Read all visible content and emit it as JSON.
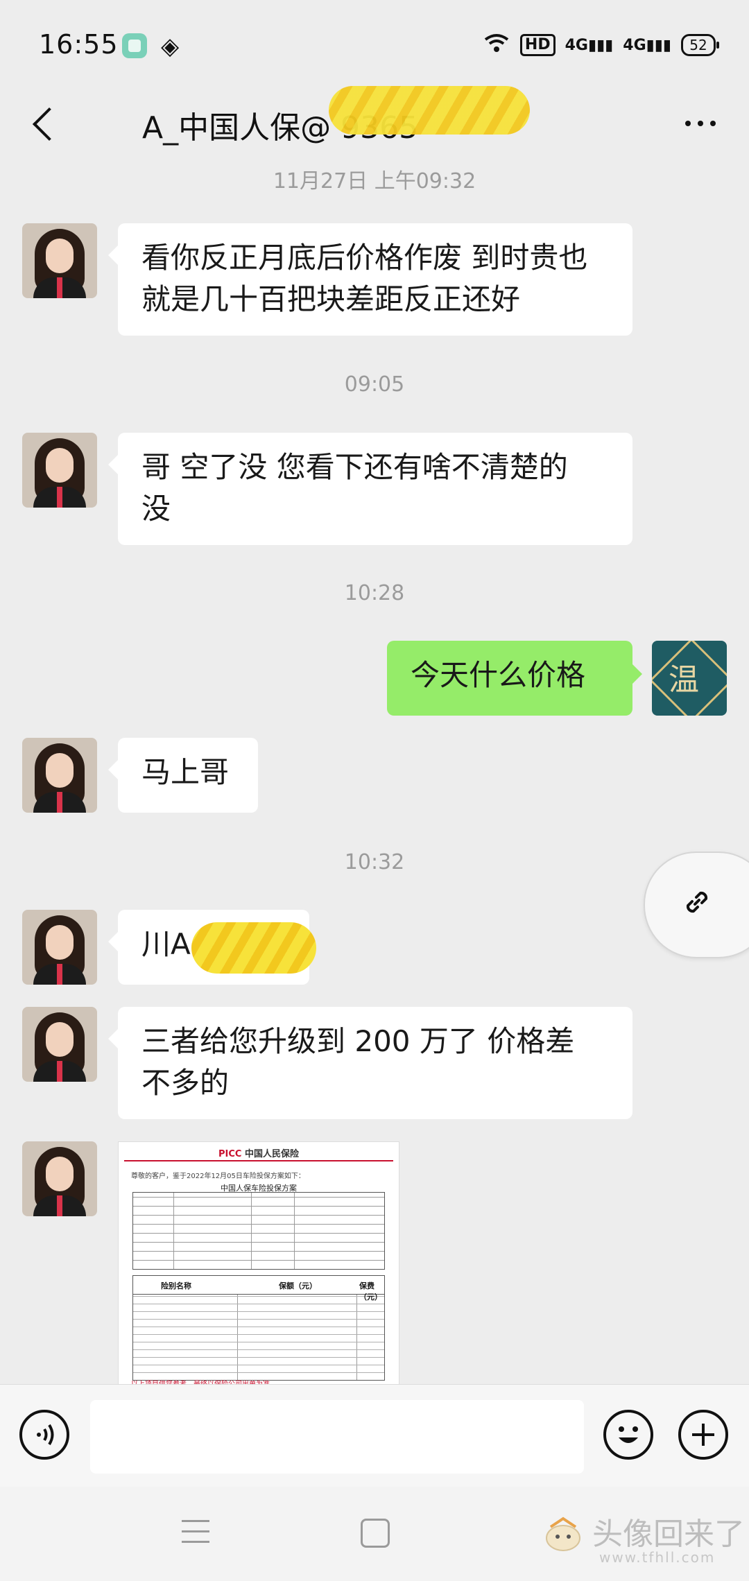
{
  "status_bar": {
    "time": "16:55",
    "network": "4G",
    "network2": "4G",
    "hd": "HD",
    "battery": "52"
  },
  "header": {
    "back_icon": "chevron-left-icon",
    "title": "A_中国人保@ 9365",
    "more_icon": "more-dots-icon"
  },
  "messages": [
    {
      "type": "time",
      "text": "11月27日 上午09:32"
    },
    {
      "type": "text",
      "side": "left",
      "lines": [
        "看你反正月底后价格作废 到时贵也",
        "就是几十百把块差距反正还好"
      ]
    },
    {
      "type": "time",
      "text": "09:05"
    },
    {
      "type": "text",
      "side": "left",
      "lines": [
        "哥  空了没  您看下还有啥不清楚的",
        "没"
      ]
    },
    {
      "type": "time",
      "text": "10:28"
    },
    {
      "type": "text",
      "side": "right",
      "lines": [
        "今天什么价格"
      ]
    },
    {
      "type": "text",
      "side": "left",
      "lines": [
        "马上哥"
      ]
    },
    {
      "type": "time",
      "text": "10:32"
    },
    {
      "type": "text",
      "side": "left",
      "lines": [
        "川A"
      ]
    },
    {
      "type": "text",
      "side": "left",
      "lines": [
        "三者给您升级到 200 万了 价格差",
        "不多的"
      ]
    },
    {
      "type": "image",
      "side": "left"
    }
  ],
  "image_doc": {
    "brand": "PICC",
    "company": "中国人民保险",
    "intro": "尊敬的客户，鉴于2022年12月05日车险投保方案如下：",
    "title": "中国人保车险投保方案",
    "col_risk": "险别名称",
    "col_amount": "保额（元）",
    "col_premium": "保费（元）",
    "footer": "以上项目供您参考，最终以保险公司出单为准。"
  },
  "watermark": {
    "main": "头像回来了",
    "sub": "www.tfhll.com"
  },
  "colors": {
    "background": "#ededed",
    "bubble_in": "#ffffff",
    "bubble_out": "#95ec69",
    "timestamp": "#9b9b9b",
    "accent_red": "#c8102e"
  }
}
